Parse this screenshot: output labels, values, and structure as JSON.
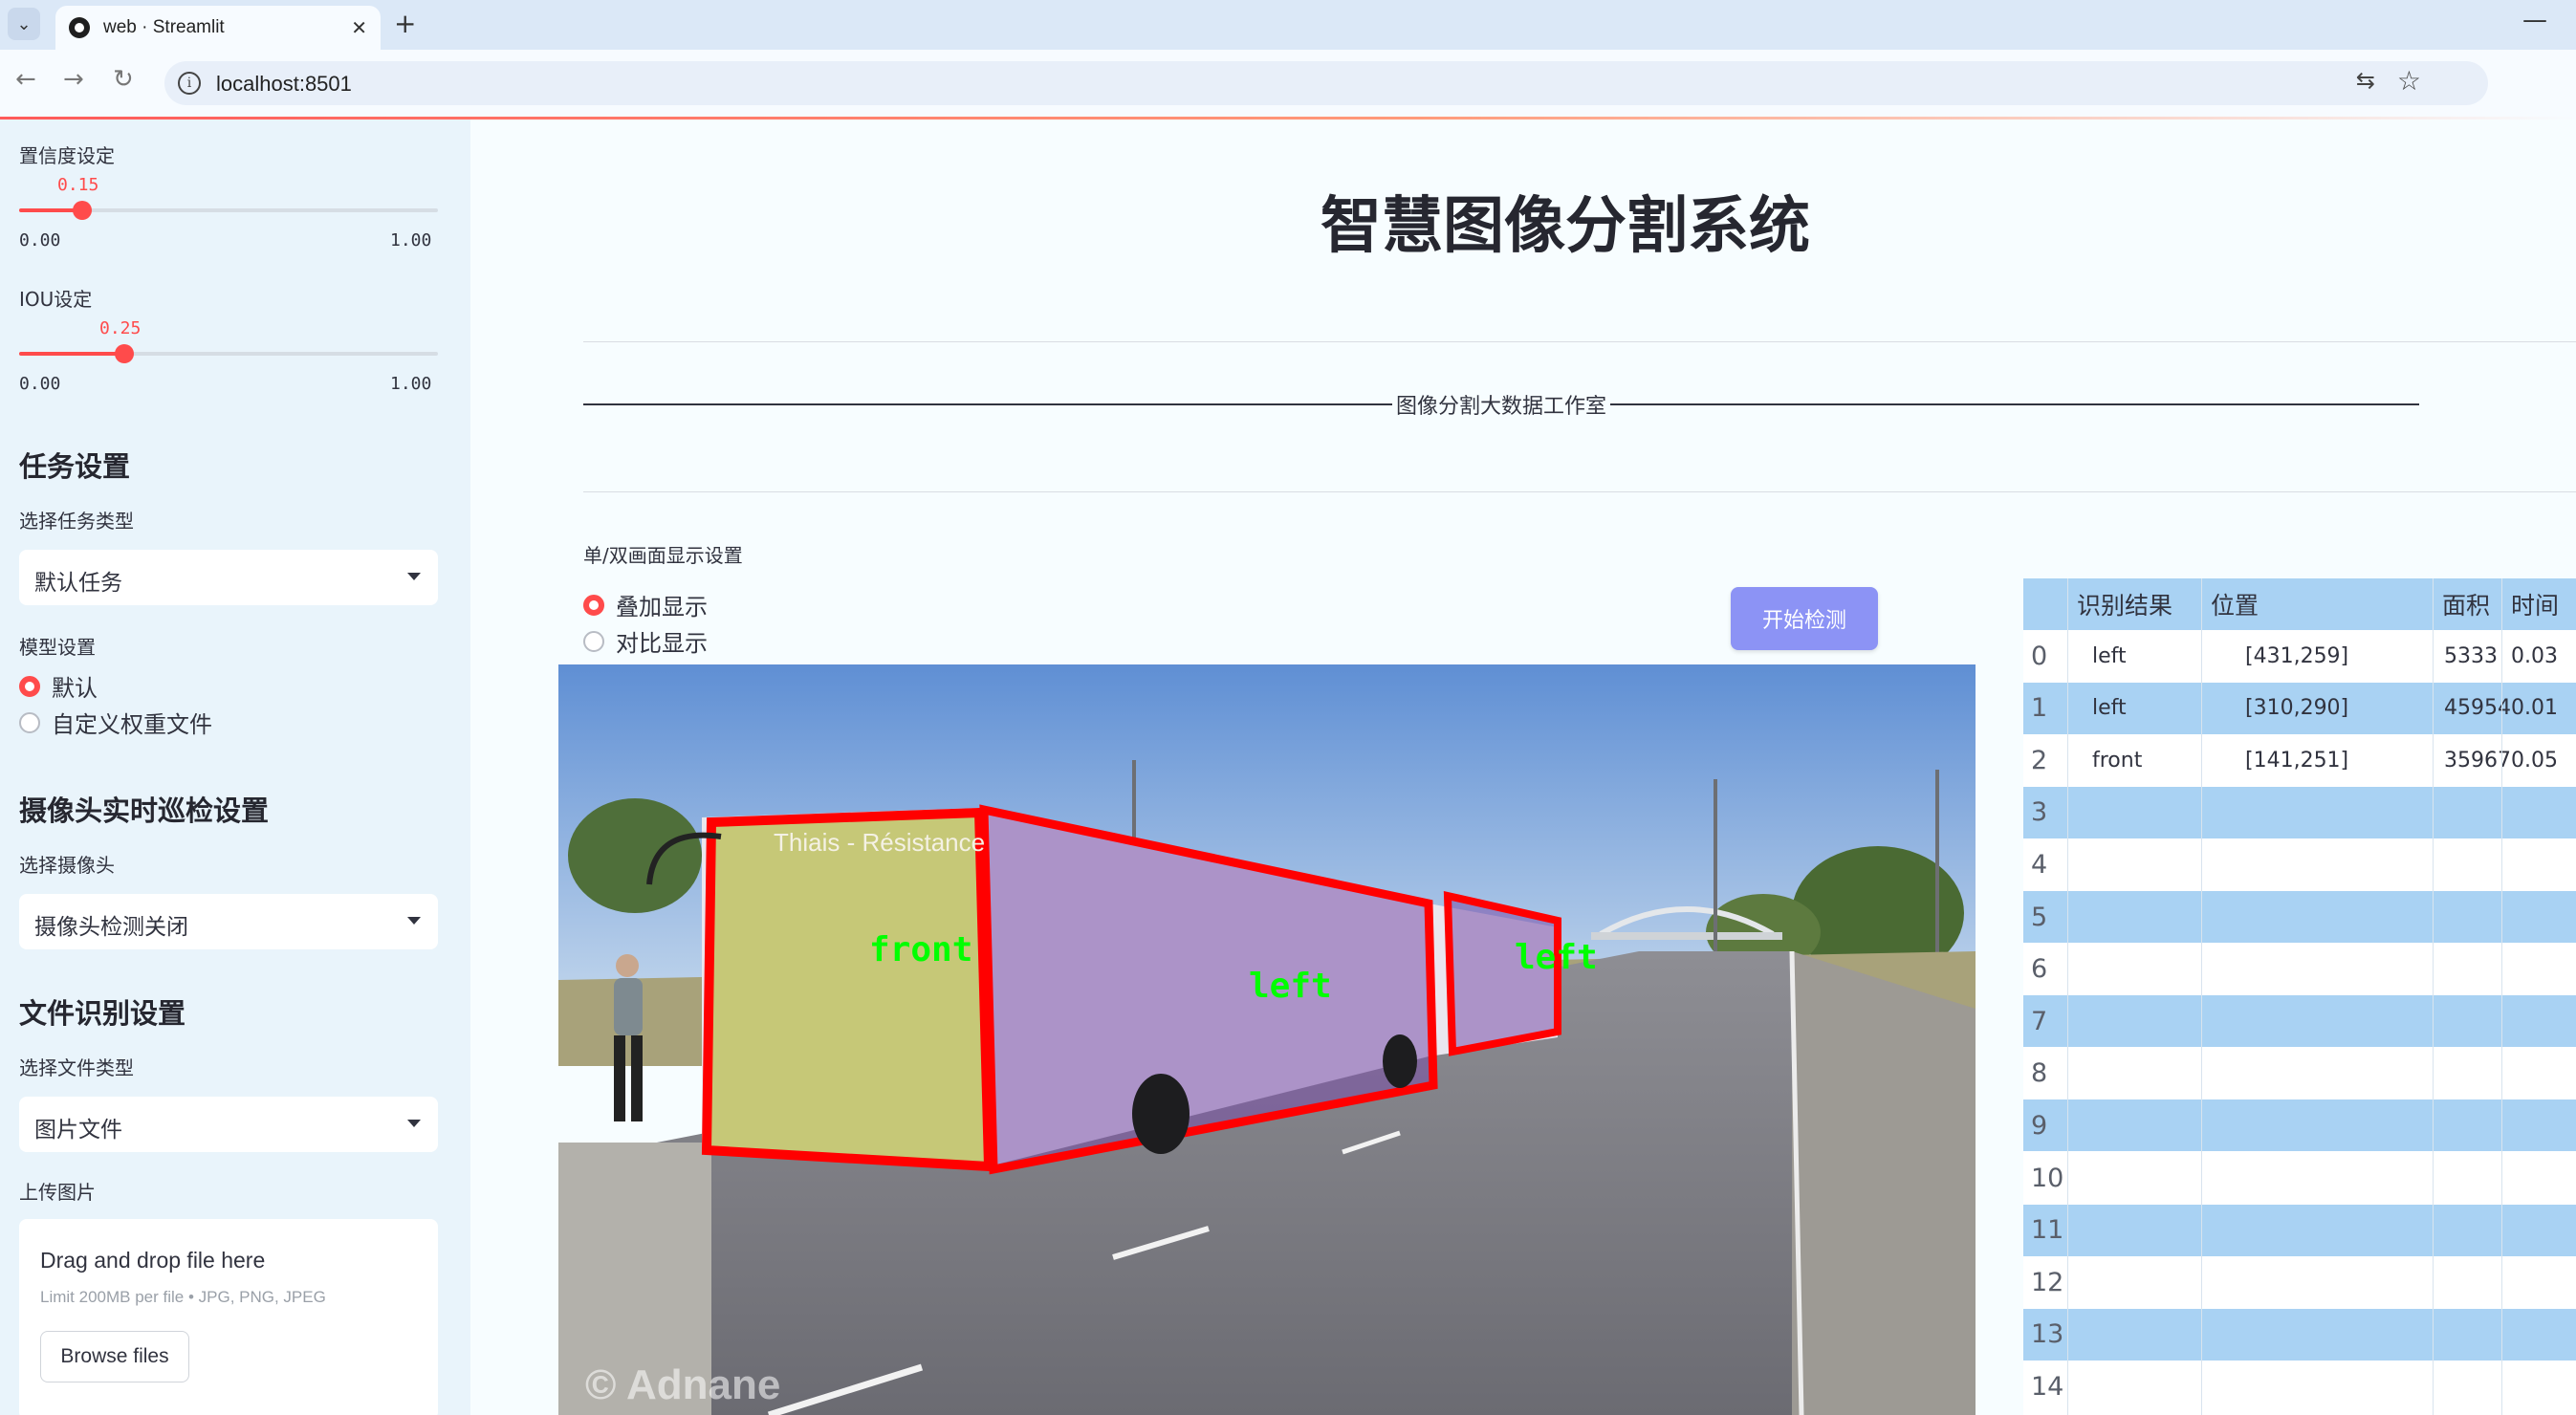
{
  "browser": {
    "tab_title": "web · Streamlit",
    "url": "localhost:8501"
  },
  "sidebar": {
    "confidence": {
      "label": "置信度设定",
      "value": "0.15",
      "min": "0.00",
      "max": "1.00",
      "fraction": 0.15
    },
    "iou": {
      "label": "IOU设定",
      "value": "0.25",
      "min": "0.00",
      "max": "1.00",
      "fraction": 0.25
    },
    "task_section": {
      "heading": "任务设置",
      "select_label": "选择任务类型",
      "selected": "默认任务"
    },
    "model_section": {
      "label": "模型设置",
      "options": [
        "默认",
        "自定义权重文件"
      ],
      "selected_index": 0
    },
    "camera_section": {
      "heading": "摄像头实时巡检设置",
      "select_label": "选择摄像头",
      "selected": "摄像头检测关闭"
    },
    "file_section": {
      "heading": "文件识别设置",
      "select_label": "选择文件类型",
      "selected": "图片文件",
      "upload_label": "上传图片"
    },
    "uploader": {
      "title": "Drag and drop file here",
      "limit": "Limit 200MB per file • JPG, PNG, JPEG",
      "button": "Browse files"
    }
  },
  "main": {
    "title": "智慧图像分割系统",
    "banner": "图像分割大数据工作室",
    "display_mode": {
      "label": "单/双画面显示设置",
      "options": [
        "叠加显示",
        "对比显示"
      ],
      "selected_index": 0
    },
    "start_button": "开始检测",
    "image": {
      "bus_sign": "Thiais - Résistance",
      "watermark": "© Adnane",
      "detections": [
        "front",
        "left",
        "left"
      ]
    }
  },
  "results_table": {
    "columns": [
      "",
      "识别结果",
      "位置",
      "面积",
      "时间"
    ],
    "rows": [
      {
        "idx": "0",
        "result": "left",
        "position": "[431,259]",
        "area": "5333",
        "time": "0.03"
      },
      {
        "idx": "1",
        "result": "left",
        "position": "[310,290]",
        "area": "45954",
        "time": "0.01"
      },
      {
        "idx": "2",
        "result": "front",
        "position": "[141,251]",
        "area": "35967",
        "time": "0.05"
      },
      {
        "idx": "3",
        "result": "",
        "position": "",
        "area": "",
        "time": ""
      },
      {
        "idx": "4",
        "result": "",
        "position": "",
        "area": "",
        "time": ""
      },
      {
        "idx": "5",
        "result": "",
        "position": "",
        "area": "",
        "time": ""
      },
      {
        "idx": "6",
        "result": "",
        "position": "",
        "area": "",
        "time": ""
      },
      {
        "idx": "7",
        "result": "",
        "position": "",
        "area": "",
        "time": ""
      },
      {
        "idx": "8",
        "result": "",
        "position": "",
        "area": "",
        "time": ""
      },
      {
        "idx": "9",
        "result": "",
        "position": "",
        "area": "",
        "time": ""
      },
      {
        "idx": "10",
        "result": "",
        "position": "",
        "area": "",
        "time": ""
      },
      {
        "idx": "11",
        "result": "",
        "position": "",
        "area": "",
        "time": ""
      },
      {
        "idx": "12",
        "result": "",
        "position": "",
        "area": "",
        "time": ""
      },
      {
        "idx": "13",
        "result": "",
        "position": "",
        "area": "",
        "time": ""
      },
      {
        "idx": "14",
        "result": "",
        "position": "",
        "area": "",
        "time": ""
      }
    ]
  },
  "colors": {
    "accent": "#ff4b4b",
    "button": "#8c93f5",
    "table_stripe": "#a9d2f3",
    "mask_fill": "#8a5fbf",
    "mask_edge": "#ff0000",
    "label_text": "#00ff00"
  }
}
